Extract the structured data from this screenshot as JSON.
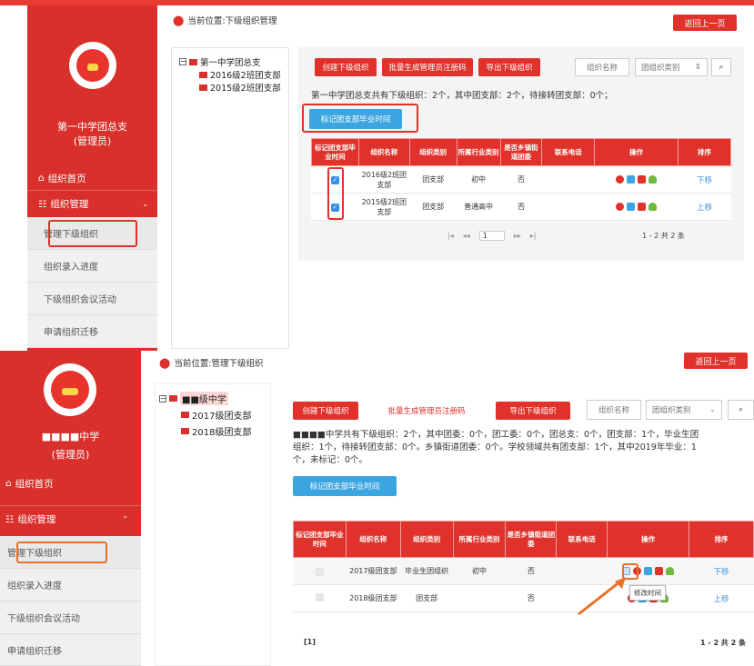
{
  "panel1": {
    "sidebar": {
      "org_name": "第一中学团总支",
      "role": "(管理员)",
      "home": "组织首页",
      "org_manage": "组织管理",
      "items": [
        "管理下级组织",
        "组织录入进度",
        "下级组织会议活动",
        "申请组织迁移"
      ]
    },
    "location": "当前位置:下级组织管理",
    "back": "返回上一页",
    "tree": {
      "root": "第一中学团总支",
      "children": [
        "2016级2班团支部",
        "2015级2班团支部"
      ]
    },
    "toolbar": {
      "create": "创建下级组织",
      "batch": "批量生成管理员注册码",
      "export": "导出下级组织",
      "name_placeholder": "组织名称",
      "type_select": "团组织类别",
      "select_arrow": "⇕",
      "search_icon": "magnifier"
    },
    "summary": "第一中学团总支共有下级组织：2个，其中团支部：2个，待接转团支部：0个；",
    "mark_btn": "标记团支部毕业时间",
    "headers": [
      "标记团支部毕业时间",
      "组织名称",
      "组织类别",
      "所属行业类别",
      "是否乡镇街道团委",
      "联系电话",
      "操作",
      "排序"
    ],
    "rows": [
      {
        "name": "2016级2班团支部",
        "type": "团支部",
        "industry": "初中",
        "town": "否",
        "phone": "",
        "move": "下移"
      },
      {
        "name": "2015级2班团支部",
        "type": "团支部",
        "industry": "普通高中",
        "town": "否",
        "phone": "",
        "move": "上移"
      }
    ],
    "pager": {
      "first": "|◂",
      "prev": "◂◂",
      "page": "1",
      "next": "▸▸",
      "last": "▸|",
      "info": "1 - 2  共 2 条"
    }
  },
  "panel2": {
    "sidebar": {
      "org_name": "■■■■中学",
      "role": "(管理员)",
      "home": "组织首页",
      "org_manage": "组织管理",
      "items": [
        "管理下级组织",
        "组织录入进度",
        "下级组织会议活动",
        "申请组织迁移"
      ]
    },
    "location": "当前位置:管理下级组织",
    "back": "返回上一页",
    "tree": {
      "root": "■■级中学",
      "children": [
        "2017级团支部",
        "2018级团支部"
      ]
    },
    "toolbar": {
      "create": "创建下级组织",
      "batch": "批量生成管理员注册码",
      "export": "导出下级组织",
      "name_placeholder": "组织名称",
      "type_select": "团组织类别",
      "select_arrow": "⌄",
      "search_icon": "magnifier"
    },
    "summary_lines": [
      "■■■■中学共有下级组织：2个，其中团委：0个，团工委：0个，团总支：0个，团支部：1个，毕业生团",
      "组织：1个，待接转团支部：0个。乡镇街道团委：0个。学校领域共有团支部：1个，其中2019年毕业：1",
      "个，未标记：0个。"
    ],
    "mark_btn": "标记团支部毕业时间",
    "headers": [
      "标记团支部毕业时间",
      "组织名称",
      "组织类别",
      "所属行业类别",
      "是否乡镇街道团委",
      "联系电话",
      "操作",
      "排序"
    ],
    "rows": [
      {
        "name": "2017级团支部",
        "type": "毕业生团组织",
        "industry": "初中",
        "town": "否",
        "phone": "",
        "move": "下移"
      },
      {
        "name": "2018级团支部",
        "type": "团支部",
        "industry": "",
        "town": "否",
        "phone": "",
        "move": "上移"
      }
    ],
    "tooltip": "修改时间",
    "pager": {
      "page": "[1]",
      "info": "1 - 2  共 2 条"
    }
  },
  "colors": {
    "brand_red": "#e0312a",
    "sidebar_red": "#d9302b",
    "blue": "#3ba5e0",
    "highlight_orange": "#e8702a"
  }
}
